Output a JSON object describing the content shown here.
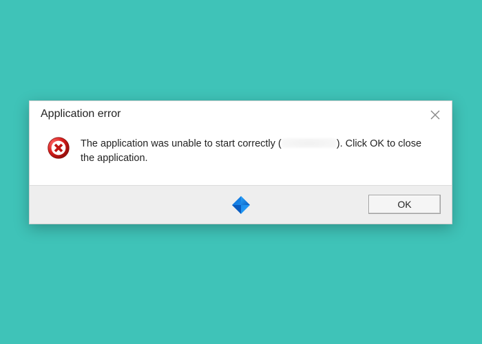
{
  "dialog": {
    "title": "Application error",
    "message_before": "The application was unable to start correctly (",
    "message_redacted": "",
    "message_after": "). Click OK to close the application.",
    "ok_label": "OK"
  }
}
